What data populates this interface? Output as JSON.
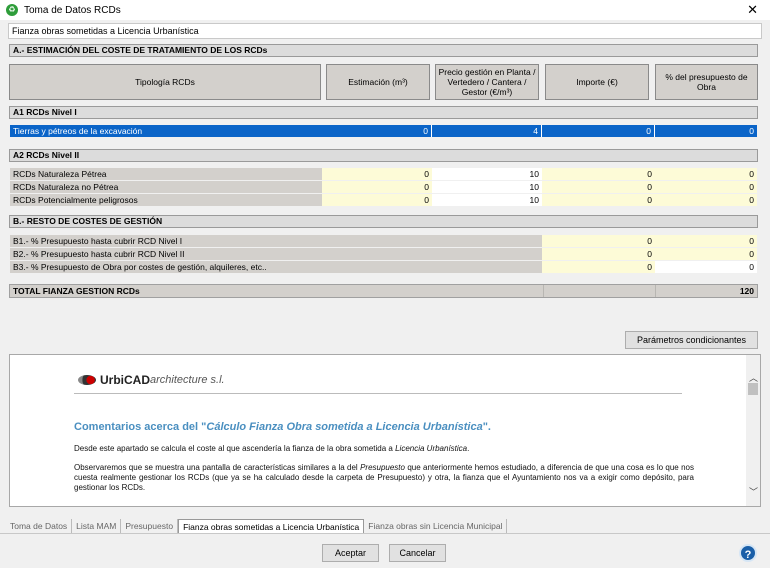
{
  "window": {
    "title": "Toma de Datos RCDs",
    "close": "✕"
  },
  "panel_title": "Fianza obras sometidas a Licencia Urbanística",
  "section_a": {
    "title": "A.- ESTIMACIÓN DEL COSTE DE TRATAMIENTO DE LOS RCDs",
    "headers": [
      "Tipología RCDs",
      "Estimación (m³)",
      "Precio gestión en Planta / Vertedero / Cantera / Gestor      (€/m³)",
      "Importe (€)",
      "% del presupuesto de Obra"
    ]
  },
  "a1": {
    "title": "A1 RCDs Nivel I",
    "rows": [
      {
        "label": "Tierras y pétreos de la excavación",
        "estimacion": "0",
        "precio": "4",
        "importe": "0",
        "pct": "0"
      }
    ]
  },
  "a2": {
    "title": "A2 RCDs Nivel II",
    "rows": [
      {
        "label": "RCDs Naturaleza Pétrea",
        "estimacion": "0",
        "precio": "10",
        "importe": "0",
        "pct": "0"
      },
      {
        "label": "RCDs Naturaleza no Pétrea",
        "estimacion": "0",
        "precio": "10",
        "importe": "0",
        "pct": "0"
      },
      {
        "label": "RCDs Potencialmente peligrosos",
        "estimacion": "0",
        "precio": "10",
        "importe": "0",
        "pct": "0"
      }
    ]
  },
  "section_b": {
    "title": "B.- RESTO DE COSTES DE GESTIÓN",
    "rows": [
      {
        "label": "B1.- % Presupuesto hasta cubrir RCD Nivel I",
        "importe": "0",
        "pct": "0"
      },
      {
        "label": "B2.- % Presupuesto hasta cubrir RCD Nivel II",
        "importe": "0",
        "pct": "0"
      },
      {
        "label": "B3.- % Presupuesto de Obra  por costes de gestión, alquileres, etc..",
        "importe": "0",
        "pct": "0"
      }
    ]
  },
  "total": {
    "label": "TOTAL FIANZA GESTION RCDs",
    "value": "120"
  },
  "params_button": "Parámetros condicionantes",
  "doc": {
    "logo_brand": "UrbiCAD",
    "logo_rest": " architecture s.l.",
    "heading_pre": "Comentarios acerca del \"",
    "heading_em": "Cálculo Fianza Obra sometida a Licencia Urbanística",
    "heading_post": "\".",
    "p1_pre": "Desde este apartado se calcula el coste al que ascendería la fianza de la obra sometida a ",
    "p1_em": "Licencia Urbanística",
    "p1_post": ".",
    "p2_pre": "Observaremos que se muestra una pantalla de características similares a la del ",
    "p2_em": "Presupuesto",
    "p2_post": " que anteriormente hemos estudiado, a diferencia de que una cosa es lo que nos cuesta realmente gestionar los RCDs (que ya se ha calculado desde la carpeta de Presupuesto) y otra, la fianza que el Ayuntamiento nos va a exigir como depósito, para gestionar los RCDs."
  },
  "tabs": [
    "Toma de Datos",
    "Lista MAM",
    "Presupuesto",
    "Fianza obras sometidas a Licencia Urbanística",
    "Fianza obras sin Licencia Municipal"
  ],
  "buttons": {
    "accept": "Aceptar",
    "cancel": "Cancelar",
    "help": "?"
  },
  "colors": {
    "selection": "#0a64c8",
    "input_yellow": "#fdfbd7",
    "label_gray": "#d3d0cc",
    "doc_heading": "#4a8fc0"
  }
}
